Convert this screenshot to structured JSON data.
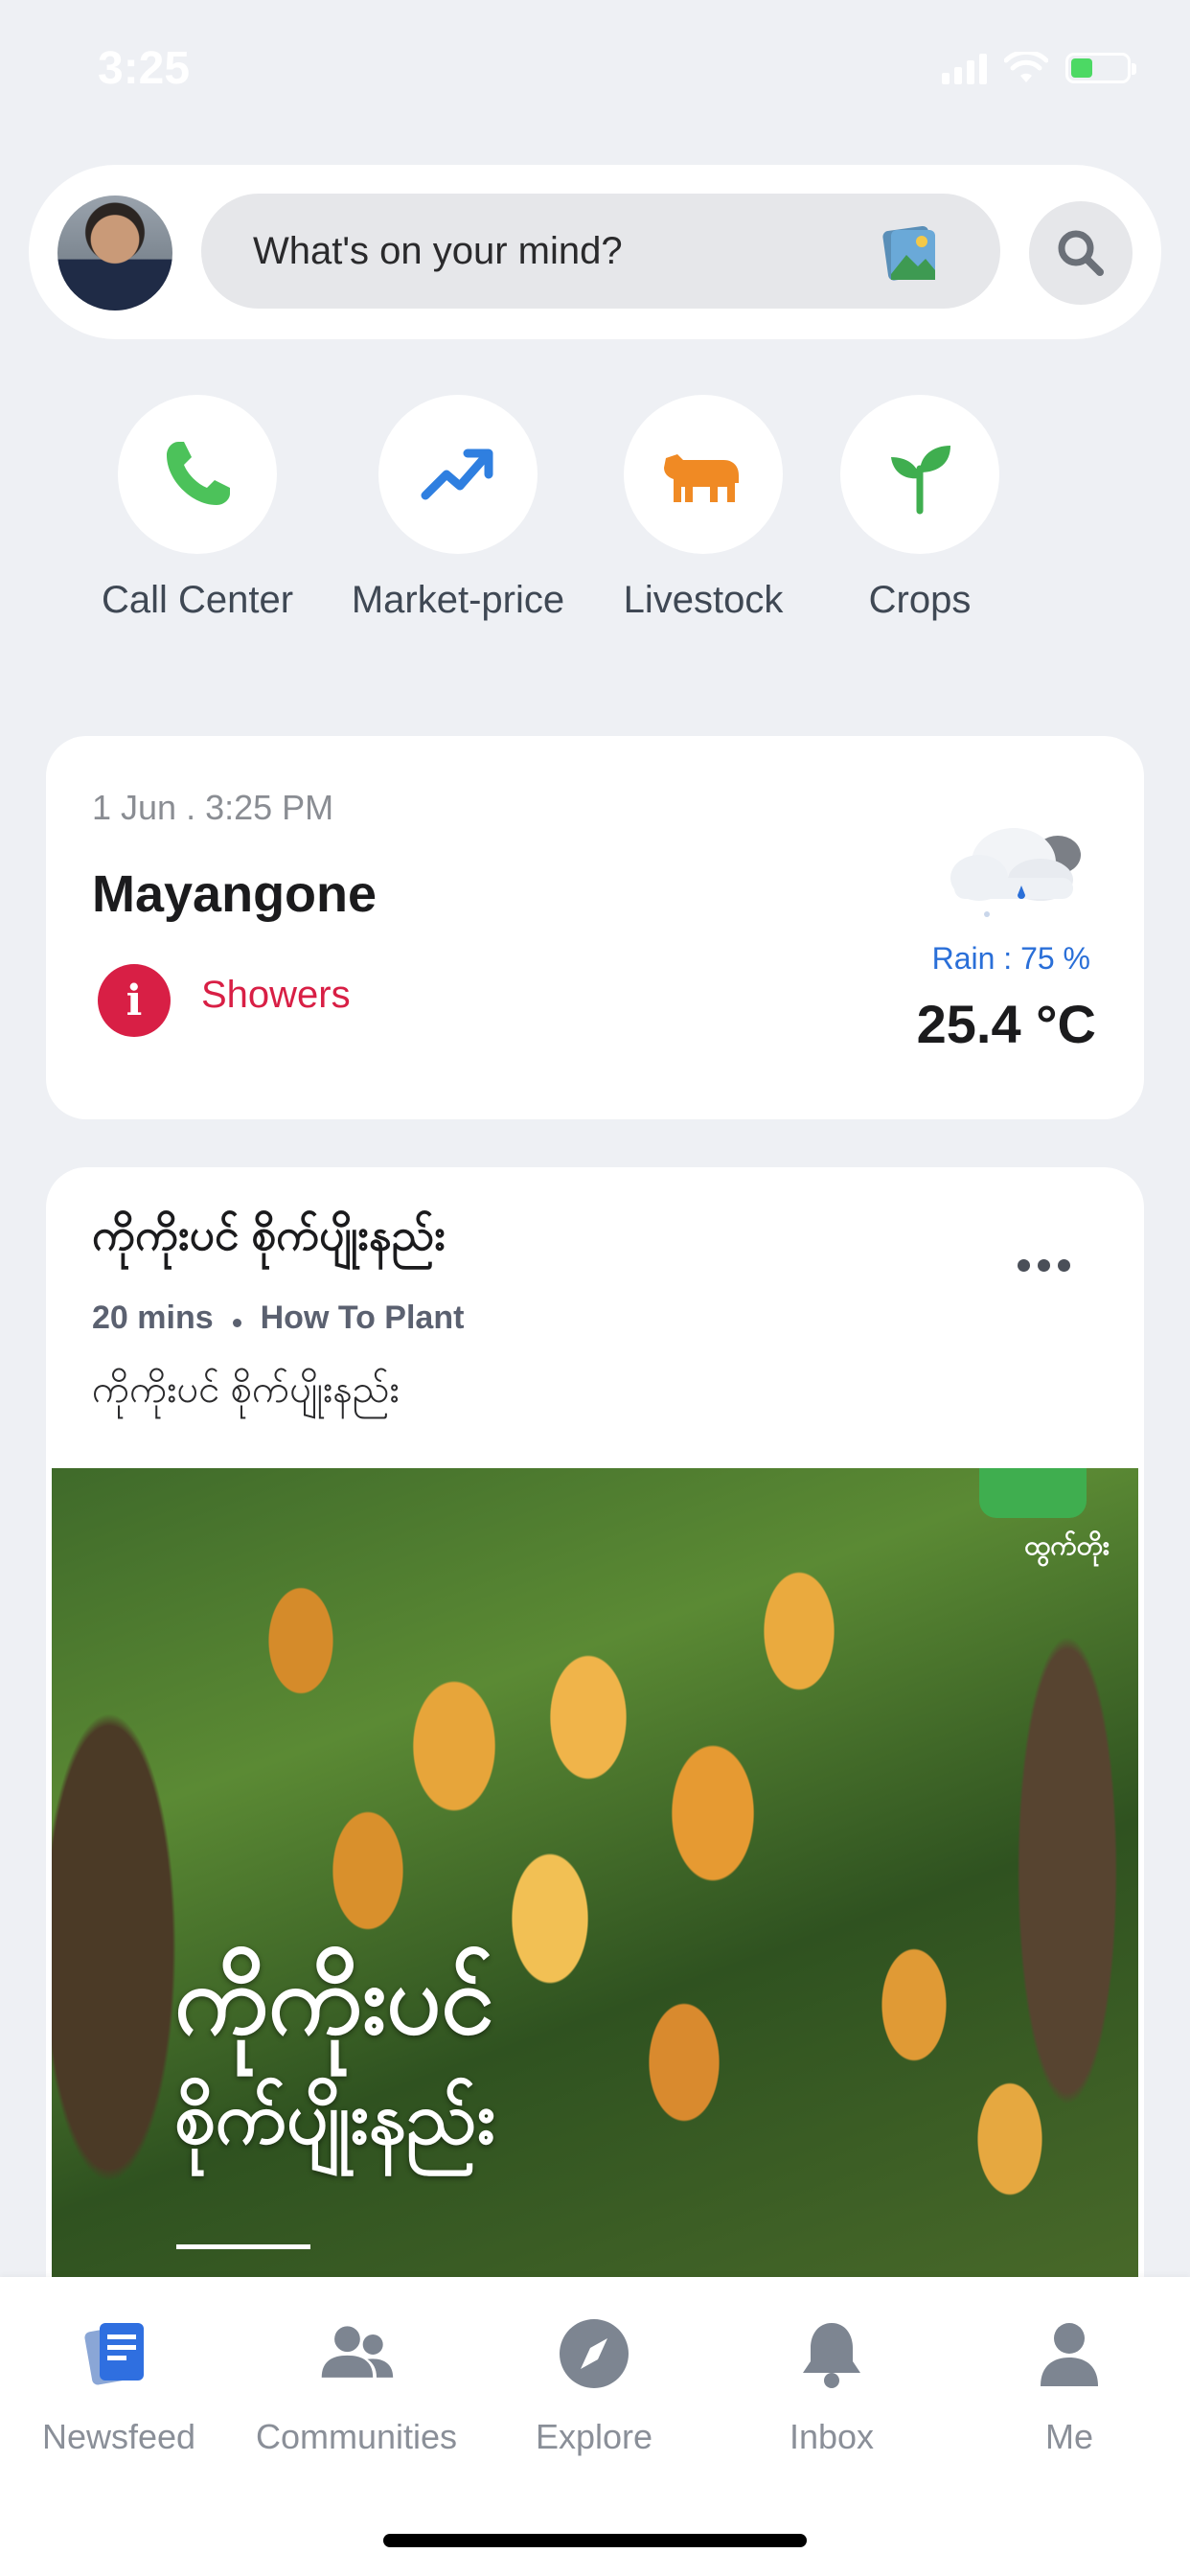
{
  "status_bar": {
    "time": "3:25"
  },
  "composer": {
    "placeholder": "What's on your mind?"
  },
  "shortcuts": [
    {
      "label": "Call Center",
      "icon": "phone-icon",
      "color": "#4cc25a"
    },
    {
      "label": "Market-price",
      "icon": "trending-up-icon",
      "color": "#2f7fe0"
    },
    {
      "label": "Livestock",
      "icon": "cow-icon",
      "color": "#f08a24"
    },
    {
      "label": "Crops",
      "icon": "sprout-icon",
      "color": "#3fae4f"
    }
  ],
  "weather": {
    "datetime": "1 Jun . 3:25 PM",
    "location": "Mayangone",
    "condition": "Showers",
    "rain": "Rain : 75 %",
    "temperature": "25.4 °C",
    "alert_icon": "info-icon",
    "accent": "#d81f45"
  },
  "post": {
    "title": "ကိုကိုးပင် စိုက်ပျိုးနည်း",
    "duration": "20 mins",
    "category": "How To Plant",
    "subtitle": "ကိုကိုးပင် စိုက်ပျိုးနည်း",
    "image_title_line1": "ကိုကိုးပင်",
    "image_title_line2": "စိုက်ပျိုးနည်း",
    "image_logo_text": "ထွက်တိုး"
  },
  "tabbar": {
    "items": [
      {
        "label": "Newsfeed",
        "icon": "newsfeed-icon",
        "active": true
      },
      {
        "label": "Communities",
        "icon": "communities-icon",
        "active": false
      },
      {
        "label": "Explore",
        "icon": "compass-icon",
        "active": false
      },
      {
        "label": "Inbox",
        "icon": "bell-icon",
        "active": false
      },
      {
        "label": "Me",
        "icon": "person-icon",
        "active": false
      }
    ]
  }
}
